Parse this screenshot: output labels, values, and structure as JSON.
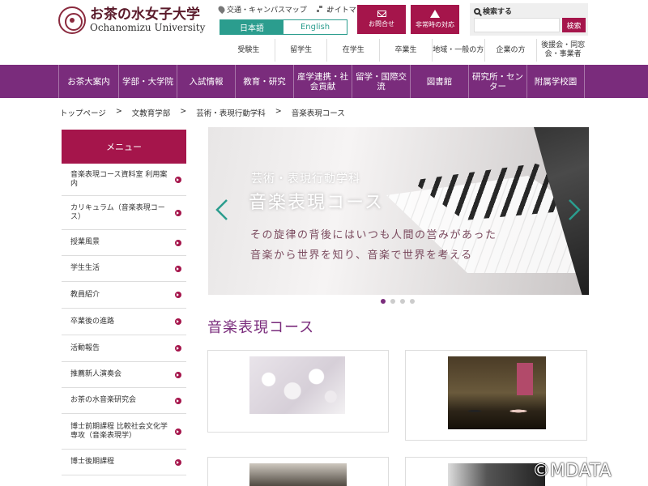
{
  "header": {
    "logo_jp": "お茶の水女子大学",
    "logo_en": "Ochanomizu University",
    "util_links": [
      "交通・キャンパスマップ",
      "サイトマップ"
    ],
    "lang": {
      "ja": "日本語",
      "en": "English"
    },
    "contact_label": "お問合せ",
    "emergency_label": "非常時の対応",
    "search": {
      "label": "検索する",
      "placeholder": "",
      "button": "検索"
    },
    "audience": [
      "受験生",
      "留学生",
      "在学生",
      "卒業生",
      "地域・一般の方",
      "企業の方",
      "後援会・同窓会・事業者"
    ]
  },
  "nav": {
    "items": [
      {
        "label": "お茶大案内",
        "w": 74
      },
      {
        "label": "学部・大学院",
        "w": 72
      },
      {
        "label": "入試情報",
        "w": 72
      },
      {
        "label": "教育・研究",
        "w": 72
      },
      {
        "label": "産学連携・社会貢献",
        "w": 72
      },
      {
        "label": "留学・国際交流",
        "w": 72
      },
      {
        "label": "図書館",
        "w": 72
      },
      {
        "label": "研究所・センター",
        "w": 72
      },
      {
        "label": "附属学校園",
        "w": 72
      }
    ]
  },
  "breadcrumb": [
    "トップページ",
    ">",
    "文教育学部",
    ">",
    "芸術・表現行動学科",
    ">",
    "音楽表現コース"
  ],
  "sidebar": {
    "heading": "メニュー",
    "items": [
      {
        "label": "音楽表現コース資料室 利用案内",
        "h": 40
      },
      {
        "label": "カリキュラム（音楽表現コース）",
        "h": 42
      },
      {
        "label": "授業風景",
        "h": 32
      },
      {
        "label": "学生生活",
        "h": 32
      },
      {
        "label": "教員紹介",
        "h": 33
      },
      {
        "label": "卒業後の進路",
        "h": 33
      },
      {
        "label": "活動報告",
        "h": 33
      },
      {
        "label": "推薦新人演奏会",
        "h": 32
      },
      {
        "label": "お茶の水音楽研究会",
        "h": 32
      },
      {
        "label": "博士前期課程 比較社会文化学専攻（音楽表現学）",
        "h": 44
      },
      {
        "label": "博士後期課程",
        "h": 32
      }
    ]
  },
  "hero": {
    "subtitle": "芸術・表現行動学科",
    "title": "音楽表現コース",
    "line1": "その旋律の背後にはいつも人間の営みがあった",
    "line2": "音楽から世界を知り、音楽で世界を考える",
    "slide_count": 4,
    "active_slide": 1
  },
  "section_title": "音楽表現コース",
  "watermark": "©MDATA",
  "colors": {
    "primary": "#7a2c7c",
    "accent": "#a5154b",
    "lang": "#2b9d8e"
  }
}
